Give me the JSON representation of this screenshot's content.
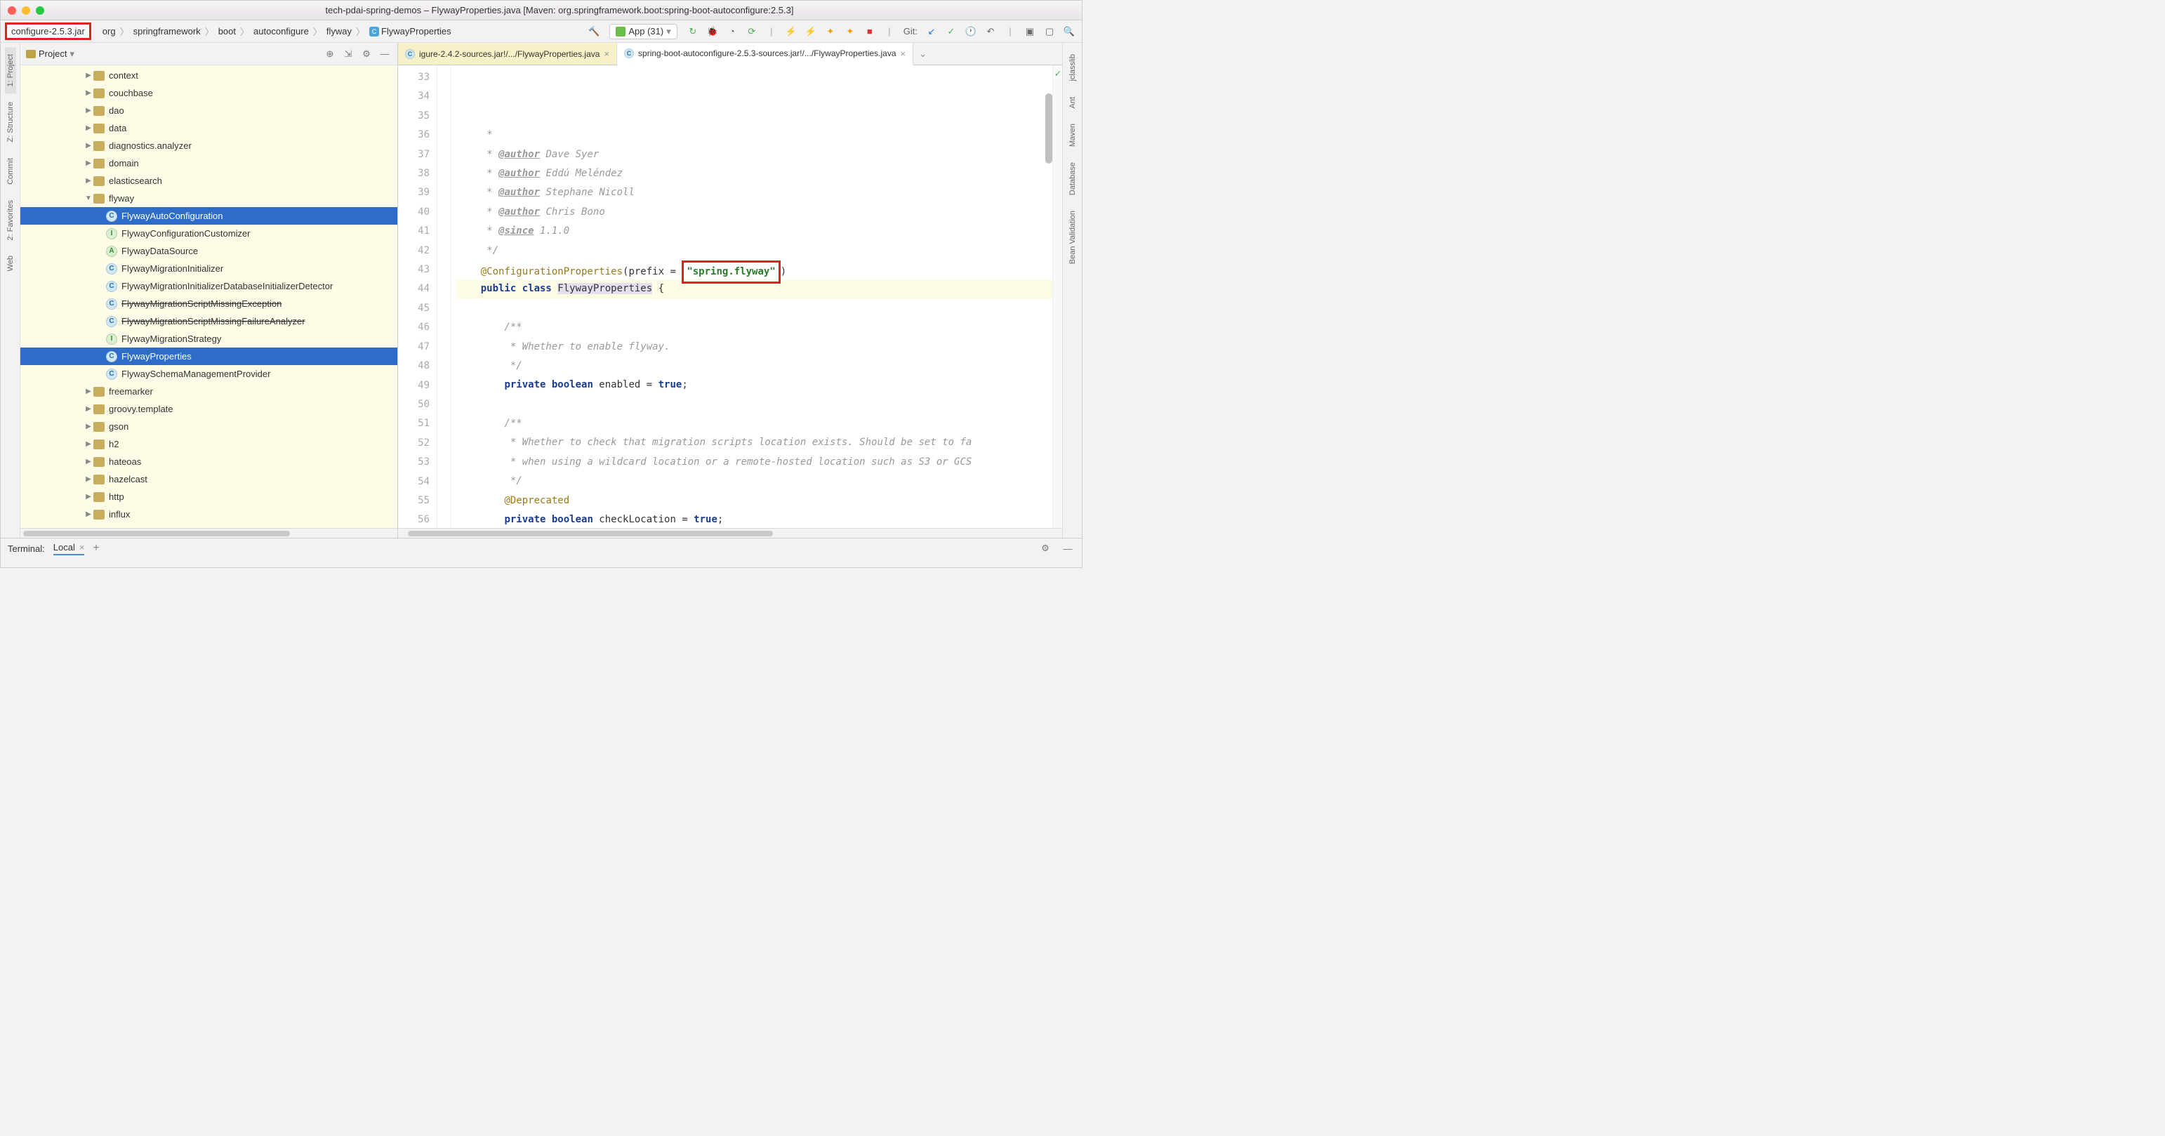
{
  "window": {
    "title": "tech-pdai-spring-demos – FlywayProperties.java [Maven: org.springframework.boot:spring-boot-autoconfigure:2.5.3]"
  },
  "jarBadge": "configure-2.5.3.jar",
  "breadcrumbs": [
    "org",
    "springframework",
    "boot",
    "autoconfigure",
    "flyway",
    "FlywayProperties"
  ],
  "runConfig": "App (31)",
  "gitLabel": "Git:",
  "leftRail": [
    "1: Project",
    "Z: Structure",
    "Commit",
    "2: Favorites",
    "Web"
  ],
  "rightRail": [
    "jclasslib",
    "Ant",
    "Maven",
    "Database",
    "Bean Validation"
  ],
  "projectPanel": {
    "title": "Project",
    "tree": [
      {
        "indent": 5,
        "type": "folder",
        "label": "context",
        "arrow": "right"
      },
      {
        "indent": 5,
        "type": "folder",
        "label": "couchbase",
        "arrow": "right"
      },
      {
        "indent": 5,
        "type": "folder",
        "label": "dao",
        "arrow": "right"
      },
      {
        "indent": 5,
        "type": "folder",
        "label": "data",
        "arrow": "right"
      },
      {
        "indent": 5,
        "type": "folder",
        "label": "diagnostics.analyzer",
        "arrow": "right"
      },
      {
        "indent": 5,
        "type": "folder",
        "label": "domain",
        "arrow": "right"
      },
      {
        "indent": 5,
        "type": "folder",
        "label": "elasticsearch",
        "arrow": "right"
      },
      {
        "indent": 5,
        "type": "folder",
        "label": "flyway",
        "arrow": "down"
      },
      {
        "indent": 6,
        "type": "class-c",
        "label": "FlywayAutoConfiguration",
        "selected": true
      },
      {
        "indent": 6,
        "type": "class-i",
        "label": "FlywayConfigurationCustomizer"
      },
      {
        "indent": 6,
        "type": "class-a",
        "label": "FlywayDataSource"
      },
      {
        "indent": 6,
        "type": "class-c",
        "label": "FlywayMigrationInitializer"
      },
      {
        "indent": 6,
        "type": "class-c",
        "label": "FlywayMigrationInitializerDatabaseInitializerDetector"
      },
      {
        "indent": 6,
        "type": "class-c",
        "label": "FlywayMigrationScriptMissingException",
        "strike": true
      },
      {
        "indent": 6,
        "type": "class-c",
        "label": "FlywayMigrationScriptMissingFailureAnalyzer",
        "strike": true
      },
      {
        "indent": 6,
        "type": "class-i",
        "label": "FlywayMigrationStrategy"
      },
      {
        "indent": 6,
        "type": "class-c",
        "label": "FlywayProperties",
        "selected": true
      },
      {
        "indent": 6,
        "type": "class-c",
        "label": "FlywaySchemaManagementProvider"
      },
      {
        "indent": 5,
        "type": "folder",
        "label": "freemarker",
        "arrow": "right"
      },
      {
        "indent": 5,
        "type": "folder",
        "label": "groovy.template",
        "arrow": "right"
      },
      {
        "indent": 5,
        "type": "folder",
        "label": "gson",
        "arrow": "right"
      },
      {
        "indent": 5,
        "type": "folder",
        "label": "h2",
        "arrow": "right"
      },
      {
        "indent": 5,
        "type": "folder",
        "label": "hateoas",
        "arrow": "right"
      },
      {
        "indent": 5,
        "type": "folder",
        "label": "hazelcast",
        "arrow": "right"
      },
      {
        "indent": 5,
        "type": "folder",
        "label": "http",
        "arrow": "right"
      },
      {
        "indent": 5,
        "type": "folder",
        "label": "influx",
        "arrow": "right"
      }
    ]
  },
  "tabs": [
    {
      "label": "igure-2.4.2-sources.jar!/.../FlywayProperties.java",
      "active": false
    },
    {
      "label": "spring-boot-autoconfigure-2.5.3-sources.jar!/.../FlywayProperties.java",
      "active": true
    }
  ],
  "code": {
    "startLine": 33,
    "lines": [
      {
        "n": 33,
        "segs": [
          {
            "t": "     *",
            "c": "comment"
          }
        ]
      },
      {
        "n": 34,
        "segs": [
          {
            "t": "     * ",
            "c": "comment"
          },
          {
            "t": "@author",
            "c": "doctag"
          },
          {
            "t": " Dave Syer",
            "c": "comment"
          }
        ]
      },
      {
        "n": 35,
        "segs": [
          {
            "t": "     * ",
            "c": "comment"
          },
          {
            "t": "@author",
            "c": "doctag"
          },
          {
            "t": " Eddú Meléndez",
            "c": "comment"
          }
        ]
      },
      {
        "n": 36,
        "segs": [
          {
            "t": "     * ",
            "c": "comment"
          },
          {
            "t": "@author",
            "c": "doctag"
          },
          {
            "t": " Stephane Nicoll",
            "c": "comment"
          }
        ]
      },
      {
        "n": 37,
        "segs": [
          {
            "t": "     * ",
            "c": "comment"
          },
          {
            "t": "@author",
            "c": "doctag"
          },
          {
            "t": " Chris Bono",
            "c": "comment"
          }
        ]
      },
      {
        "n": 38,
        "segs": [
          {
            "t": "     * ",
            "c": "comment"
          },
          {
            "t": "@since",
            "c": "doctag"
          },
          {
            "t": " 1.1.0",
            "c": "comment"
          }
        ]
      },
      {
        "n": 39,
        "segs": [
          {
            "t": "     */",
            "c": "comment"
          }
        ]
      },
      {
        "n": 40,
        "segs": [
          {
            "t": "    ",
            "c": ""
          },
          {
            "t": "@ConfigurationProperties",
            "c": "ann"
          },
          {
            "t": "(prefix = ",
            "c": ""
          },
          {
            "t": "\"spring.flyway\"",
            "c": "str",
            "box": true
          },
          {
            "t": ")",
            "c": ""
          }
        ]
      },
      {
        "n": 41,
        "hl": true,
        "segs": [
          {
            "t": "    ",
            "c": ""
          },
          {
            "t": "public class ",
            "c": "kw"
          },
          {
            "t": "FlywayProperties",
            "c": "classname"
          },
          {
            "t": " {",
            "c": ""
          }
        ]
      },
      {
        "n": 42,
        "segs": []
      },
      {
        "n": 43,
        "segs": [
          {
            "t": "        /**",
            "c": "comment"
          }
        ]
      },
      {
        "n": 44,
        "segs": [
          {
            "t": "         * Whether to enable flyway.",
            "c": "comment"
          }
        ]
      },
      {
        "n": 45,
        "segs": [
          {
            "t": "         */",
            "c": "comment"
          }
        ]
      },
      {
        "n": 46,
        "segs": [
          {
            "t": "        ",
            "c": ""
          },
          {
            "t": "private boolean ",
            "c": "kw"
          },
          {
            "t": "enabled = ",
            "c": ""
          },
          {
            "t": "true",
            "c": "kw"
          },
          {
            "t": ";",
            "c": ""
          }
        ]
      },
      {
        "n": 47,
        "segs": []
      },
      {
        "n": 48,
        "segs": [
          {
            "t": "        /**",
            "c": "comment"
          }
        ]
      },
      {
        "n": 49,
        "segs": [
          {
            "t": "         * Whether to check that migration scripts location exists. Should be set to fa",
            "c": "comment"
          }
        ]
      },
      {
        "n": 50,
        "segs": [
          {
            "t": "         * when using a wildcard location or a remote-hosted location such as S3 or GCS",
            "c": "comment"
          }
        ]
      },
      {
        "n": 51,
        "segs": [
          {
            "t": "         */",
            "c": "comment"
          }
        ]
      },
      {
        "n": 52,
        "segs": [
          {
            "t": "        ",
            "c": ""
          },
          {
            "t": "@Deprecated",
            "c": "ann"
          }
        ]
      },
      {
        "n": 53,
        "segs": [
          {
            "t": "        ",
            "c": ""
          },
          {
            "t": "private boolean ",
            "c": "kw"
          },
          {
            "t": "checkLocation = ",
            "c": ""
          },
          {
            "t": "true",
            "c": "kw"
          },
          {
            "t": ";",
            "c": ""
          }
        ]
      },
      {
        "n": 54,
        "segs": []
      },
      {
        "n": 55,
        "segs": [
          {
            "t": "        /**",
            "c": "comment"
          }
        ]
      },
      {
        "n": 56,
        "segs": []
      }
    ]
  },
  "terminal": {
    "title": "Terminal:",
    "tab": "Local"
  }
}
